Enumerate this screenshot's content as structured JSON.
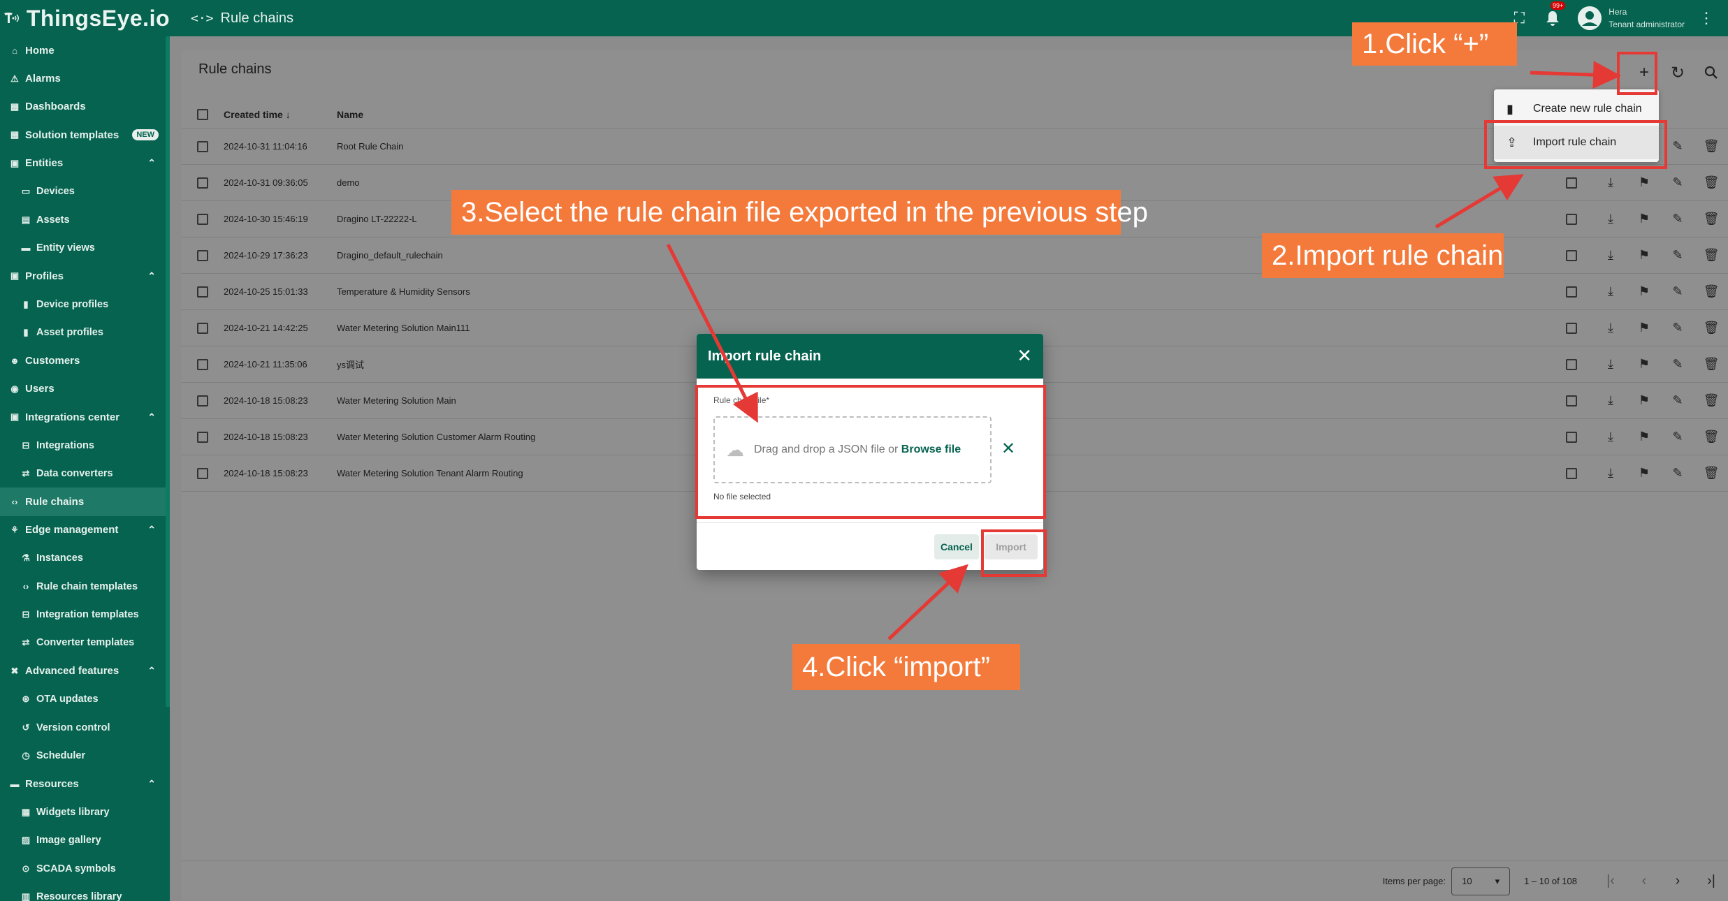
{
  "app": {
    "logo_text": "ThingsEye.io",
    "breadcrumb": "Rule chains",
    "notification_count": "99+",
    "user_name": "Hera",
    "user_role": "Tenant administrator"
  },
  "sidebar": {
    "items": [
      {
        "label": "Home",
        "icon": "home-icon",
        "glyph": "⌂",
        "type": "top"
      },
      {
        "label": "Alarms",
        "icon": "alarm-icon",
        "glyph": "⚠",
        "type": "top"
      },
      {
        "label": "Dashboards",
        "icon": "dashboard-icon",
        "glyph": "▦",
        "type": "top"
      },
      {
        "label": "Solution templates",
        "icon": "grid-icon",
        "glyph": "▦",
        "type": "top",
        "badge": "NEW"
      },
      {
        "label": "Entities",
        "icon": "entities-icon",
        "glyph": "▣",
        "type": "top",
        "expanded": true
      },
      {
        "label": "Devices",
        "icon": "devices-icon",
        "glyph": "▭",
        "type": "sub"
      },
      {
        "label": "Assets",
        "icon": "assets-icon",
        "glyph": "▤",
        "type": "sub"
      },
      {
        "label": "Entity views",
        "icon": "entity-views-icon",
        "glyph": "▬",
        "type": "sub"
      },
      {
        "label": "Profiles",
        "icon": "profiles-icon",
        "glyph": "▣",
        "type": "top",
        "expanded": true
      },
      {
        "label": "Device profiles",
        "icon": "device-profile-icon",
        "glyph": "▮",
        "type": "sub"
      },
      {
        "label": "Asset profiles",
        "icon": "asset-profile-icon",
        "glyph": "▮",
        "type": "sub"
      },
      {
        "label": "Customers",
        "icon": "customers-icon",
        "glyph": "☻",
        "type": "top"
      },
      {
        "label": "Users",
        "icon": "users-icon",
        "glyph": "◉",
        "type": "top"
      },
      {
        "label": "Integrations center",
        "icon": "integrations-center-icon",
        "glyph": "▣",
        "type": "top",
        "expanded": true
      },
      {
        "label": "Integrations",
        "icon": "integrations-icon",
        "glyph": "⊟",
        "type": "sub"
      },
      {
        "label": "Data converters",
        "icon": "converters-icon",
        "glyph": "⇄",
        "type": "sub"
      },
      {
        "label": "Rule chains",
        "icon": "rule-chains-icon",
        "glyph": "‹›",
        "type": "top",
        "active": true
      },
      {
        "label": "Edge management",
        "icon": "edge-icon",
        "glyph": "⚘",
        "type": "top",
        "expanded": true
      },
      {
        "label": "Instances",
        "icon": "instances-icon",
        "glyph": "⚗",
        "type": "sub"
      },
      {
        "label": "Rule chain templates",
        "icon": "rule-chain-templates-icon",
        "glyph": "‹›",
        "type": "sub"
      },
      {
        "label": "Integration templates",
        "icon": "integration-templates-icon",
        "glyph": "⊟",
        "type": "sub"
      },
      {
        "label": "Converter templates",
        "icon": "converter-templates-icon",
        "glyph": "⇄",
        "type": "sub"
      },
      {
        "label": "Advanced features",
        "icon": "tools-icon",
        "glyph": "✖",
        "type": "top",
        "expanded": true
      },
      {
        "label": "OTA updates",
        "icon": "ota-icon",
        "glyph": "⊛",
        "type": "sub"
      },
      {
        "label": "Version control",
        "icon": "history-icon",
        "glyph": "↺",
        "type": "sub"
      },
      {
        "label": "Scheduler",
        "icon": "clock-icon",
        "glyph": "◷",
        "type": "sub"
      },
      {
        "label": "Resources",
        "icon": "folder-icon",
        "glyph": "▬",
        "type": "top",
        "expanded": true
      },
      {
        "label": "Widgets library",
        "icon": "widgets-icon",
        "glyph": "▦",
        "type": "sub"
      },
      {
        "label": "Image gallery",
        "icon": "image-icon",
        "glyph": "▨",
        "type": "sub"
      },
      {
        "label": "SCADA symbols",
        "icon": "scada-icon",
        "glyph": "⊙",
        "type": "sub"
      },
      {
        "label": "Resources library",
        "icon": "library-icon",
        "glyph": "▥",
        "type": "sub"
      }
    ]
  },
  "main": {
    "title": "Rule chains",
    "columns": {
      "created_time": "Created time ↓",
      "name": "Name"
    },
    "rows": [
      {
        "time": "2024-10-31 11:04:16",
        "name": "Root Rule Chain"
      },
      {
        "time": "2024-10-31 09:36:05",
        "name": "demo"
      },
      {
        "time": "2024-10-30 15:46:19",
        "name": "Dragino LT-22222-L"
      },
      {
        "time": "2024-10-29 17:36:23",
        "name": "Dragino_default_rulechain"
      },
      {
        "time": "2024-10-25 15:01:33",
        "name": "Temperature & Humidity Sensors"
      },
      {
        "time": "2024-10-21 14:42:25",
        "name": "Water Metering Solution Main111"
      },
      {
        "time": "2024-10-21 11:35:06",
        "name": "ys调试"
      },
      {
        "time": "2024-10-18 15:08:23",
        "name": "Water Metering Solution Main"
      },
      {
        "time": "2024-10-18 15:08:23",
        "name": "Water Metering Solution Customer Alarm Routing"
      },
      {
        "time": "2024-10-18 15:08:23",
        "name": "Water Metering Solution Tenant Alarm Routing"
      }
    ],
    "footer": {
      "items_per_page_label": "Items per page:",
      "items_per_page_value": "10",
      "range": "1 – 10 of 108"
    }
  },
  "menu": {
    "create_label": "Create new rule chain",
    "import_label": "Import rule chain"
  },
  "dialog": {
    "title": "Import rule chain",
    "field_label": "Rule chain file*",
    "drop_text": "Drag and drop a JSON file or",
    "browse_text": "Browse file",
    "no_file": "No file selected",
    "cancel_label": "Cancel",
    "import_label": "Import"
  },
  "annotations": {
    "step1": "1.Click  “+”",
    "step2": "2.Import rule chain",
    "step3": "3.Select the rule chain file exported in the previous step",
    "step4": "4.Click  “import”",
    "callout_color": "#f47a3c",
    "box_color": "#e53935"
  },
  "colors": {
    "brand": "#05634f"
  }
}
